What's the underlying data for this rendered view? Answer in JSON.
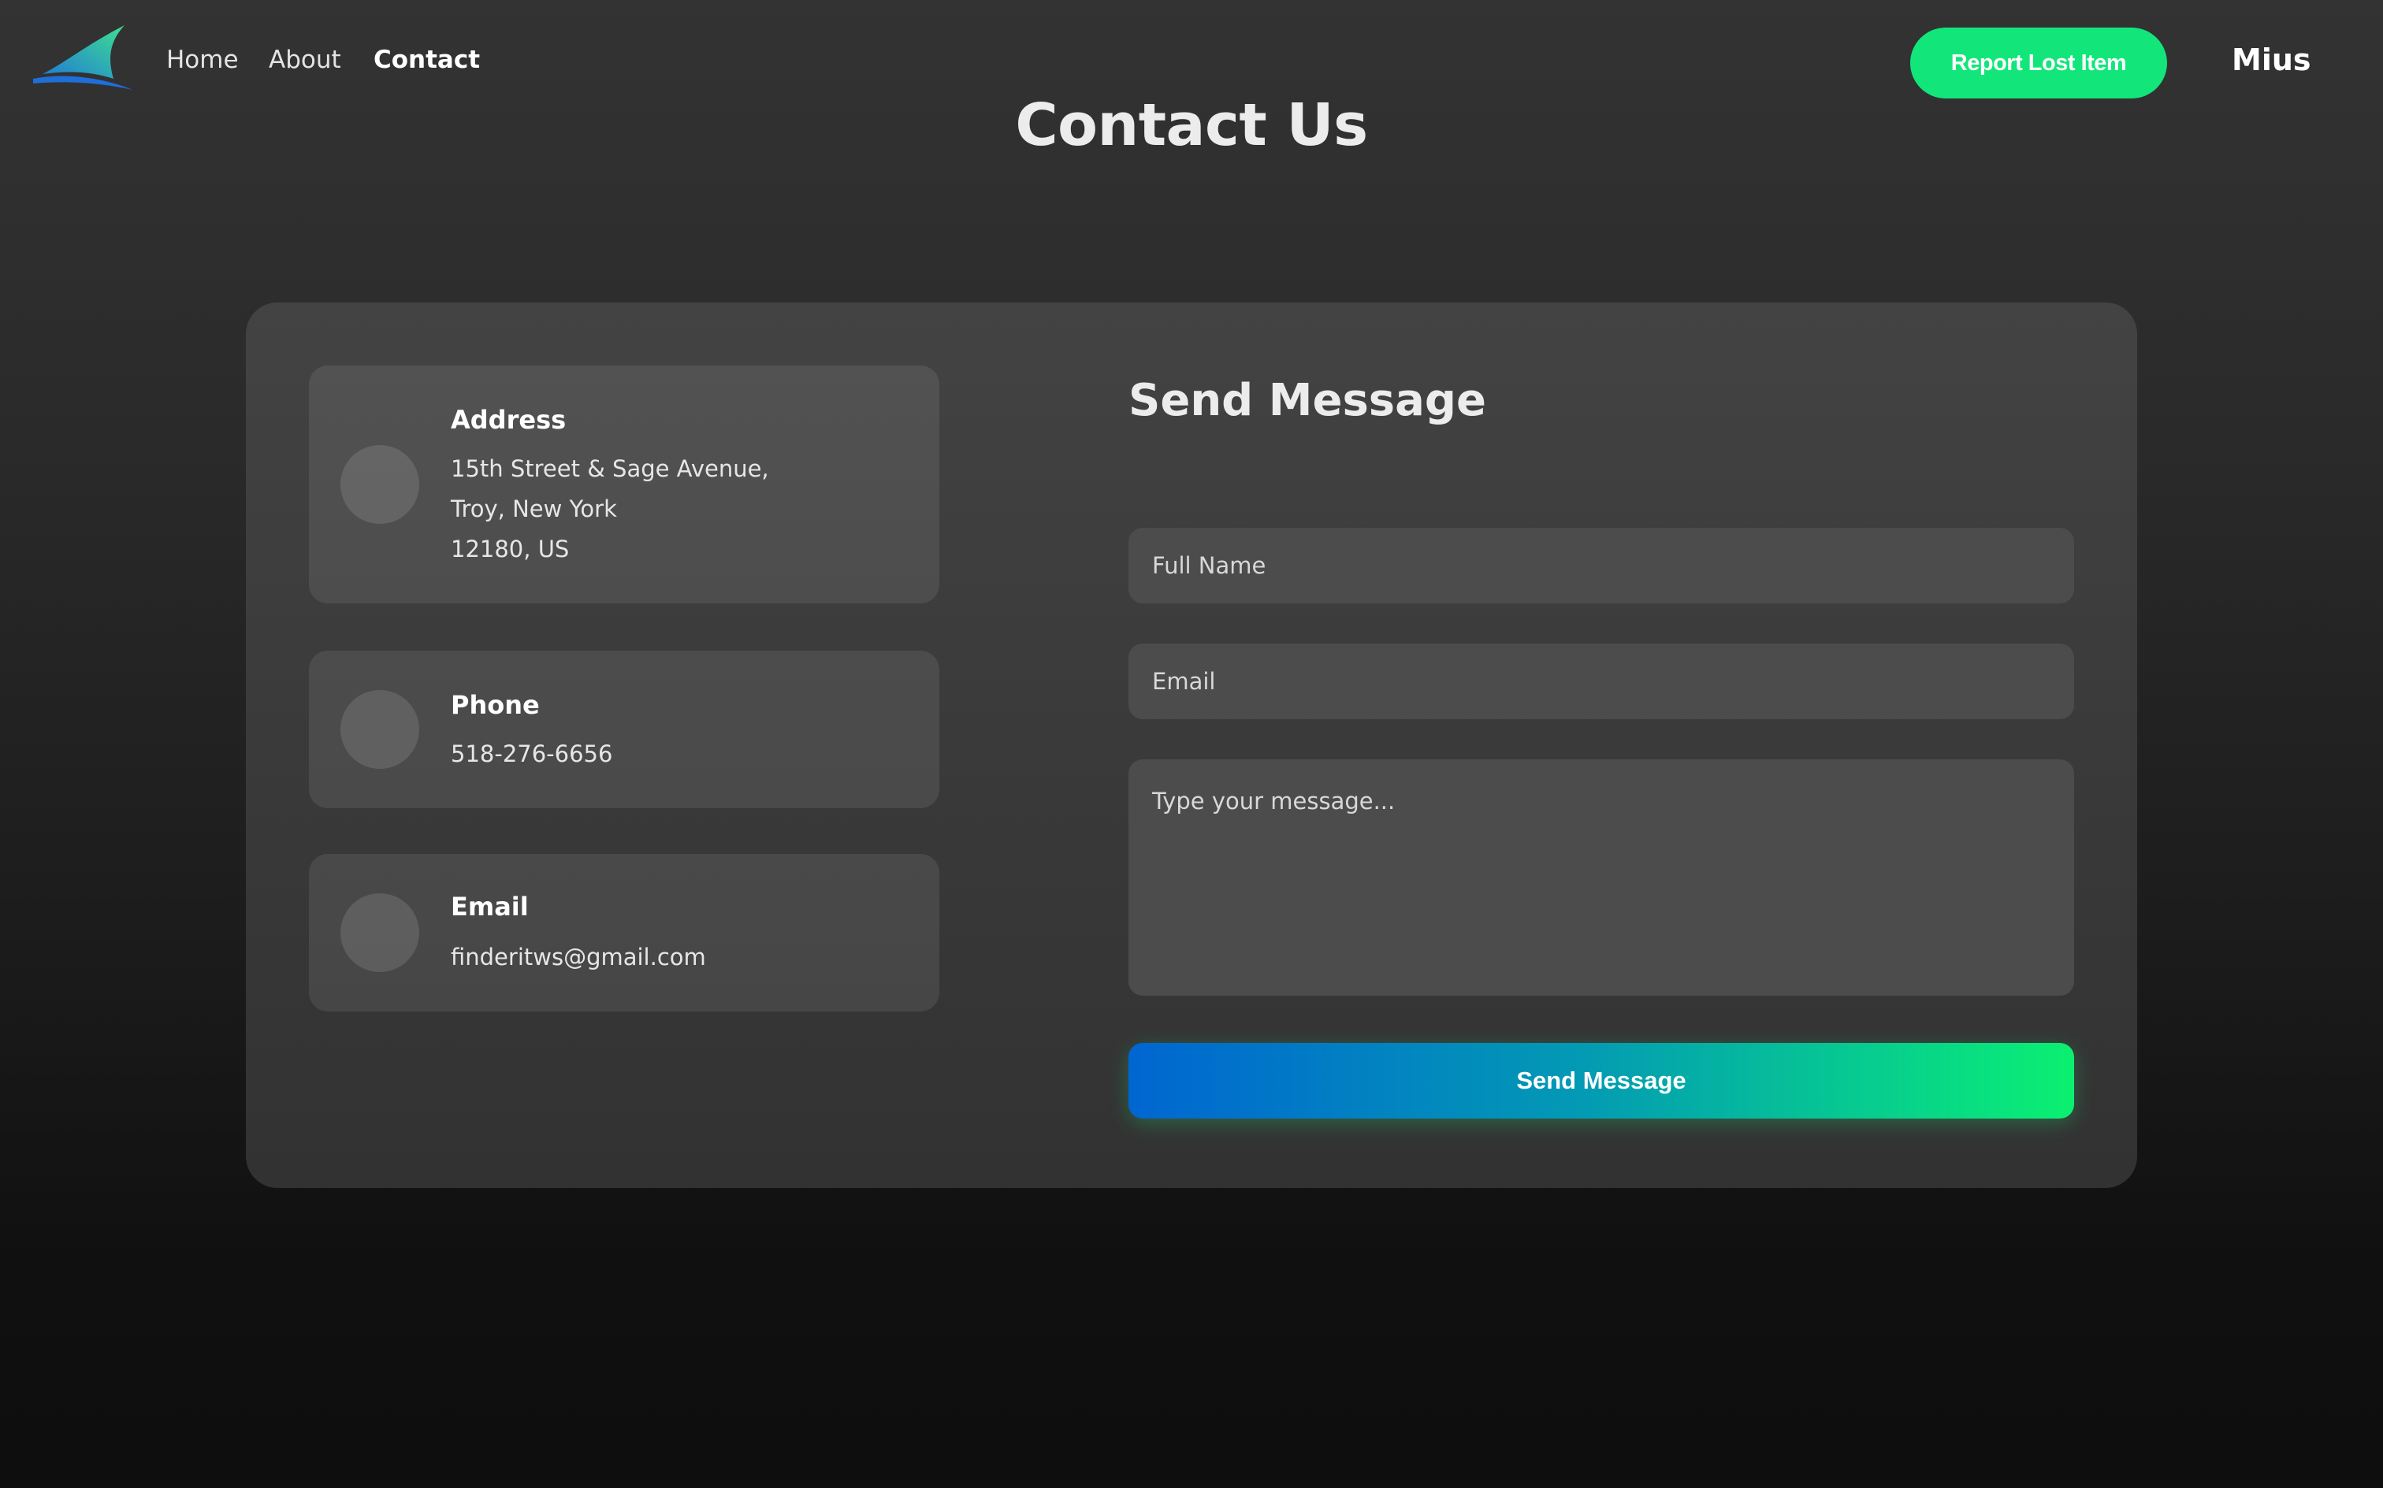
{
  "nav": {
    "logo_icon": "shark-fin-logo",
    "links": [
      {
        "label": "Home",
        "active": false
      },
      {
        "label": "About",
        "active": false
      },
      {
        "label": "Contact",
        "active": true
      }
    ],
    "report_button": "Report Lost Item",
    "user": "Mius"
  },
  "page": {
    "title": "Contact Us"
  },
  "contact_info": {
    "address": {
      "title": "Address",
      "lines": [
        "15th Street & Sage Avenue,",
        "Troy, New York",
        "12180, US"
      ]
    },
    "phone": {
      "title": "Phone",
      "value": "518-276-6656"
    },
    "email": {
      "title": "Email",
      "value": "finderitws@gmail.com"
    }
  },
  "form": {
    "heading": "Send Message",
    "full_name_placeholder": "Full Name",
    "email_placeholder": "Email",
    "message_placeholder": "Type your message...",
    "submit_label": "Send Message"
  },
  "colors": {
    "background": "#2d2d2d",
    "card": "#3d3d3d",
    "accent_green": "#12e67a",
    "accent_blue": "#0066d1"
  }
}
